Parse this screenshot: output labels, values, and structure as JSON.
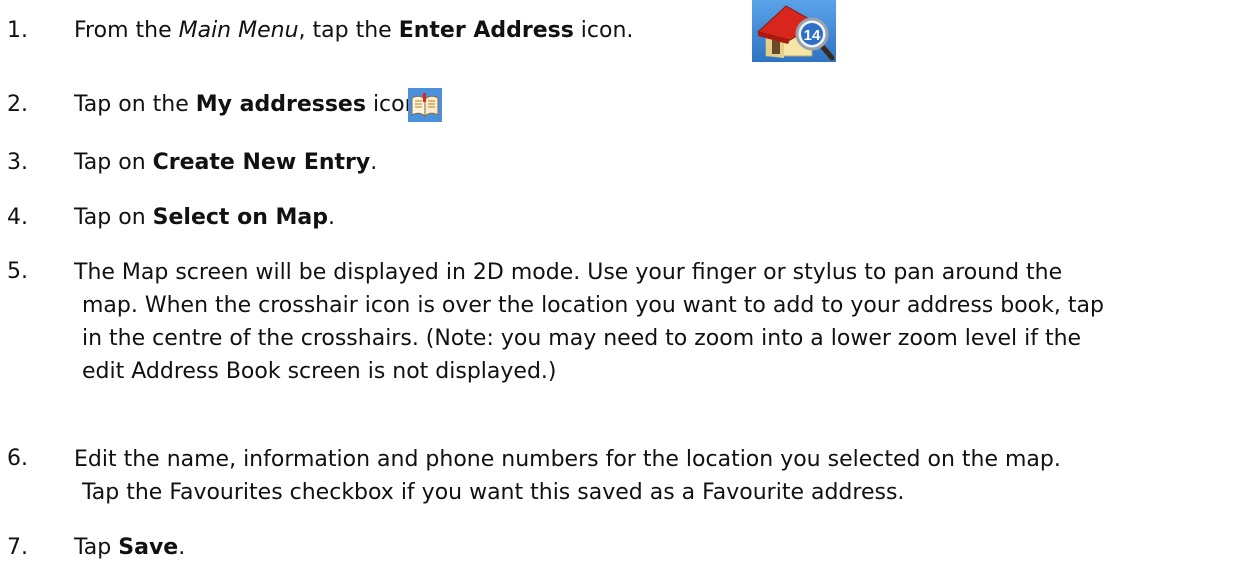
{
  "steps": [
    {
      "number": "1.",
      "parts": {
        "a": "From the ",
        "b_italic": "Main Menu",
        "c": ", tap the ",
        "d_bold": "Enter Address",
        "e": " icon."
      },
      "icon": "enter-address-house-magnifier-icon"
    },
    {
      "number": "2.",
      "parts": {
        "a": "Tap on the ",
        "b_bold": "My addresses",
        "c": " icon."
      },
      "icon": "my-addresses-book-icon"
    },
    {
      "number": "3.",
      "parts": {
        "a": "Tap on ",
        "b_bold": "Create New Entry",
        "c": "."
      }
    },
    {
      "number": "4.",
      "parts": {
        "a": "Tap on ",
        "b_bold": "Select on Map",
        "c": "."
      }
    },
    {
      "number": "5.",
      "lines": [
        "The Map screen will be displayed in 2D mode.  Use your finger or stylus to pan around the",
        "map.  When the crosshair icon is over the location you want to add to your address book, tap",
        "in the centre of the crosshairs.  (Note: you may need to zoom into a lower zoom level if the",
        "edit Address Book screen is not displayed.)"
      ]
    },
    {
      "number": "6.",
      "lines": [
        "Edit the name, information and phone numbers for the location you selected on the map.",
        "Tap the Favourites checkbox if you want this saved as a Favourite address."
      ]
    },
    {
      "number": "7.",
      "parts": {
        "a": "Tap ",
        "b_bold": "Save",
        "c": "."
      }
    }
  ],
  "icons": {
    "house_badge_number": "14",
    "colors": {
      "icon_bg": "#3a86d4",
      "roof": "#d8261c",
      "wall": "#f4e7a6",
      "badge": "#2f6fc6"
    }
  }
}
